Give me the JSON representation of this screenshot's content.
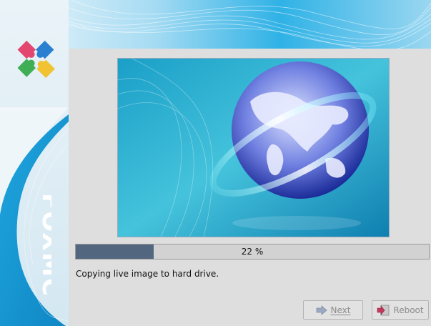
{
  "window": {
    "title": ""
  },
  "brand": {
    "text": "FOXMC"
  },
  "progress": {
    "value": 0.22,
    "label": "22 %"
  },
  "status": {
    "message": "Copying live image to hard drive."
  },
  "buttons": {
    "next_label": "Next",
    "reboot_label": "Reboot"
  },
  "icons": {
    "logo": "puzzle-logo-icon",
    "next": "arrow-right-icon",
    "reboot": "reboot-icon"
  },
  "colors": {
    "accent": "#1aa3d8",
    "progress_fill": "#52677f",
    "disabled_text": "#8c8c8c"
  }
}
